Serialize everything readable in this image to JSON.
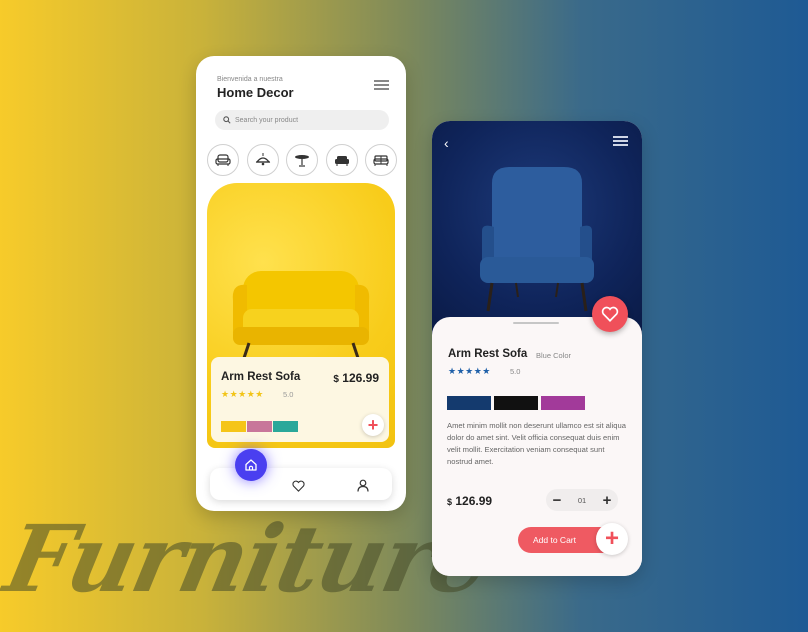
{
  "background_text": "Furniture",
  "home": {
    "greeting": "Bienvenida a nuestra",
    "title": "Home Decor",
    "search_placeholder": "Search your product",
    "categories": [
      "armchair-icon",
      "lamp-icon",
      "table-icon",
      "sofa-icon",
      "couch-icon"
    ],
    "product": {
      "name": "Arm Rest Sofa",
      "currency": "$",
      "price": "126.99",
      "stars": "★★★★★",
      "rating": "5.0",
      "swatches": [
        "#f5c518",
        "#c8769a",
        "#2aa89a"
      ],
      "add_label": "+"
    },
    "nav": [
      "home-icon",
      "heart-icon",
      "user-icon"
    ]
  },
  "detail": {
    "back": "‹",
    "product_name": "Arm Rest Sofa",
    "color_label": "Blue Color",
    "stars": "★★★★★",
    "rating": "5.0",
    "swatches": [
      "#143a6e",
      "#111111",
      "#a23a9a"
    ],
    "description": "Amet minim mollit non deserunt ullamco est sit aliqua dolor do amet sint. Velit officia consequat duis enim velit mollit. Exercitation veniam consequat sunt nostrud amet.",
    "currency": "$",
    "price": "126.99",
    "quantity": "01",
    "minus": "−",
    "plus": "+",
    "cart_label": "Add to Cart",
    "cart_plus": "+"
  },
  "colors": {
    "accent": "#f0505a",
    "nav_active": "#4a3ff0",
    "star_yellow": "#f2c417",
    "star_blue": "#1e5fa8"
  }
}
